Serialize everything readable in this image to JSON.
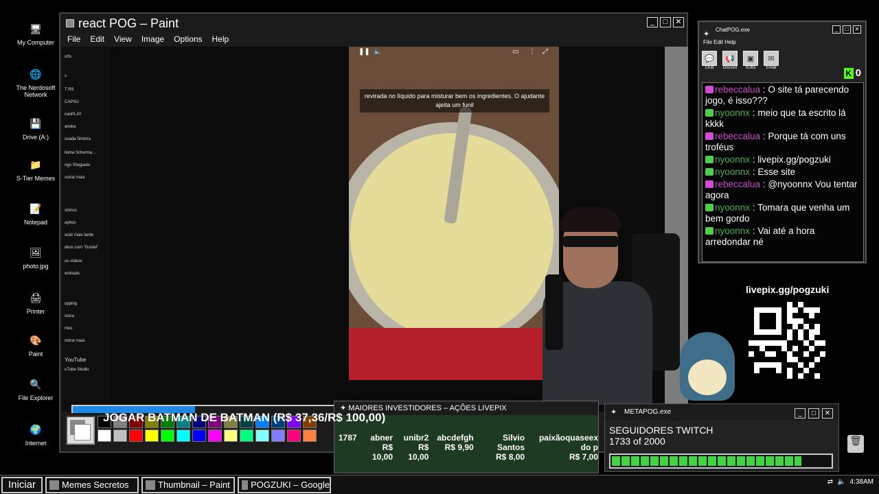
{
  "desktop": {
    "icons": [
      {
        "label": "My Computer",
        "icon": "computer-icon"
      },
      {
        "label": "The Nerdosoft Network",
        "icon": "network-icon"
      },
      {
        "label": "Drive (A:)",
        "icon": "floppy-drive-icon"
      },
      {
        "label": "S-Tier Memes",
        "icon": "folder-icon"
      },
      {
        "label": "Notepad",
        "icon": "notepad-icon"
      },
      {
        "label": "photo.jpg",
        "icon": "image-file-icon"
      },
      {
        "label": "Printer",
        "icon": "printer-icon"
      },
      {
        "label": "Paint",
        "icon": "paint-icon"
      },
      {
        "label": "File Explorer",
        "icon": "file-explorer-icon"
      },
      {
        "label": "Internet",
        "icon": "internet-icon"
      }
    ]
  },
  "paint": {
    "title": "react POG – Paint",
    "menu": [
      "File",
      "Edit",
      "View",
      "Image",
      "Options",
      "Help"
    ],
    "sidebar_items": [
      "orts",
      "s",
      "T RS",
      "CAPSU",
      "nanPLAY",
      "arioka",
      "oxada Sinistra",
      "iloma Scherma...",
      "ngo Shejpado",
      "ostrar mais",
      "stórico",
      "aylists",
      "sistir mais tarde",
      "deos com \"Gostei\"",
      "us vídeos",
      "wnloads",
      "opping",
      "úsica",
      "mes",
      "ostrar mais",
      "YouTube",
      "uTube Studio"
    ],
    "subtitle": "revirada no líquido para misturar bem os ingredientes. O ajudante ajeita um funil",
    "goal": {
      "text": "JOGAR BATMAN DE BATMAN (R$ 37,36/R$ 100,00)",
      "progress": 0.3736
    },
    "palette": [
      "#000000",
      "#808080",
      "#800000",
      "#808000",
      "#008000",
      "#008080",
      "#000080",
      "#800080",
      "#808040",
      "#004040",
      "#0080ff",
      "#004080",
      "#8000ff",
      "#804000",
      "#ffffff",
      "#c0c0c0",
      "#ff0000",
      "#ffff00",
      "#00ff00",
      "#00ffff",
      "#0000ff",
      "#ff00ff",
      "#ffff80",
      "#00ff80",
      "#80ffff",
      "#8080ff",
      "#ff0080",
      "#ff8040"
    ]
  },
  "chat": {
    "title": "ChatPOG.exe",
    "menu": "File Edit Help",
    "tools": [
      "Chat",
      "Discord",
      "SUBs",
      "Email"
    ],
    "kick_count": "0",
    "messages": [
      {
        "user": "rebeccalua",
        "text": "O site tá parecendo jogo, é isso???",
        "kind": "pink"
      },
      {
        "user": "nyoonnx",
        "text": "meio que ta escrito lá kkkk",
        "kind": "green"
      },
      {
        "user": "rebeccalua",
        "text": "Porque tá com uns troféus",
        "kind": "pink"
      },
      {
        "user": "nyoonnx",
        "text": "livepix.gg/pogzuki",
        "kind": "green"
      },
      {
        "user": "nyoonnx",
        "text": "Esse site",
        "kind": "green"
      },
      {
        "user": "rebeccalua",
        "text": "@nyoonnx Vou tentar agora",
        "kind": "pink"
      },
      {
        "user": "nyoonnx",
        "text": "Tomara que venha um bem gordo",
        "kind": "green"
      },
      {
        "user": "nyoonnx",
        "text": "Vai até a hora arredondar né",
        "kind": "green"
      }
    ]
  },
  "qr": {
    "label": "livepix.gg/pogzuki"
  },
  "investors": {
    "title": "MAIORES INVESTIDORES – AÇÕES LIVEPIX",
    "items": [
      {
        "name": "1787",
        "value": ""
      },
      {
        "name": "abner",
        "value": "R$ 10,00"
      },
      {
        "name": "unibr2",
        "value": "R$ 10,00"
      },
      {
        "name": "abcdefgh",
        "value": "R$ 9,90"
      },
      {
        "name": "Silvio Santos",
        "value": "R$ 8,00"
      },
      {
        "name": "paixãoquaseex do p",
        "value": "R$ 7,00"
      }
    ]
  },
  "meta": {
    "title": "METAPOG.exe",
    "label": "SEGUIDORES TWITCH",
    "count": "1733 of 2000",
    "progress": 0.8665
  },
  "taskbar": {
    "start": "Iniciar",
    "tasks": [
      "Memes Secretos",
      "Thumbnail – Paint",
      "POGZUKI – Google"
    ],
    "clock": "4:38AM"
  }
}
